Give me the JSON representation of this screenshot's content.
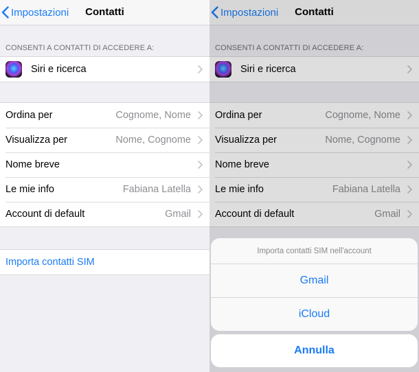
{
  "nav": {
    "back_label": "Impostazioni",
    "title": "Contatti"
  },
  "section_header": "CONSENTI A CONTATTI DI ACCEDERE A:",
  "siri": {
    "label": "Siri e ricerca"
  },
  "settings": [
    {
      "label": "Ordina per",
      "value": "Cognome, Nome"
    },
    {
      "label": "Visualizza per",
      "value": "Nome, Cognome"
    },
    {
      "label": "Nome breve",
      "value": ""
    },
    {
      "label": "Le mie info",
      "value": "Fabiana Latella"
    },
    {
      "label": "Account di default",
      "value": "Gmail"
    }
  ],
  "import_sim": {
    "label": "Importa contatti SIM"
  },
  "action_sheet": {
    "title": "Importa contatti SIM nell'account",
    "options": [
      "Gmail",
      "iCloud"
    ],
    "cancel": "Annulla"
  },
  "colors": {
    "accent": "#1a7cf5",
    "background": "#efeff4",
    "secondary_text": "#8e8e93"
  }
}
